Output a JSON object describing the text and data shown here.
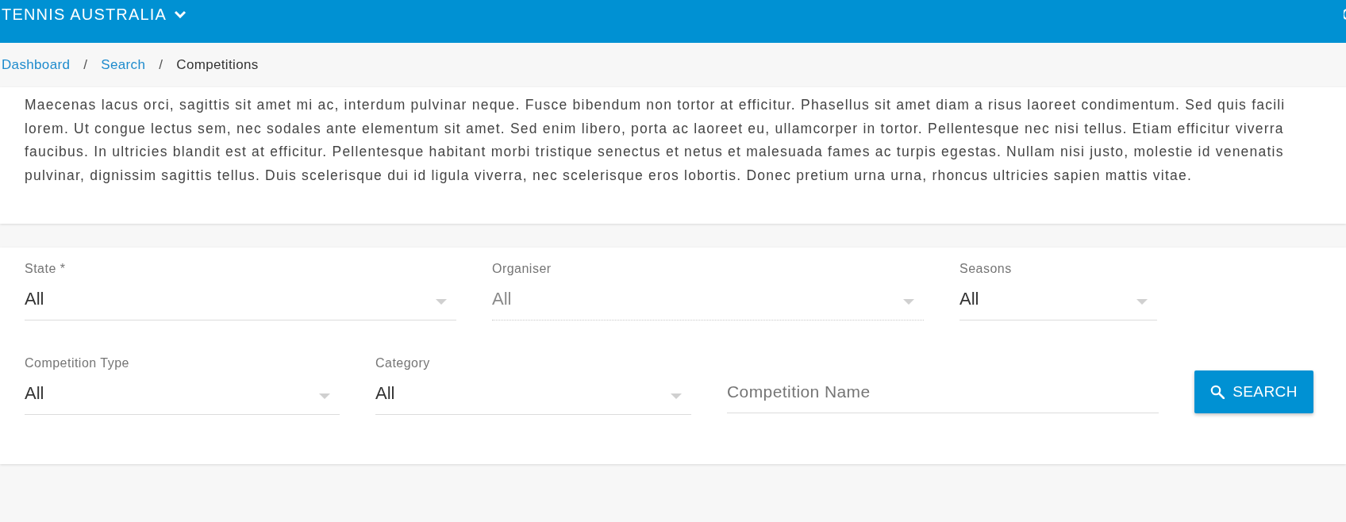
{
  "header": {
    "title": "TENNIS AUSTRALIA"
  },
  "breadcrumbs": [
    {
      "kind": "link",
      "label": "Dashboard"
    },
    {
      "kind": "separator",
      "label": "/"
    },
    {
      "kind": "link",
      "label": "Search"
    },
    {
      "kind": "separator",
      "label": "/"
    },
    {
      "kind": "current",
      "label": "Competitions"
    }
  ],
  "description": {
    "lines": [
      "Maecenas lacus orci, sagittis sit amet mi ac, interdum pulvinar neque. Fusce bibendum non tortor at efficitur. Phasellus sit amet diam a risus laoreet condimentum. Sed quis facili",
      "lorem. Ut congue lectus sem, nec sodales ante elementum sit amet. Sed enim libero, porta ac laoreet eu, ullamcorper in tortor. Pellentesque nec nisi tellus. Etiam efficitur viverra",
      "faucibus. In ultricies blandit est at efficitur. Pellentesque habitant morbi tristique senectus et netus et malesuada fames ac turpis egestas. Nullam nisi justo, molestie id venenatis",
      "pulvinar, dignissim sagittis tellus. Duis scelerisque dui id ligula viverra, nec scelerisque eros lobortis. Donec pretium urna urna, rhoncus ultricies sapien mattis vitae."
    ]
  },
  "filters": {
    "rows": [
      [
        {
          "kind": "select",
          "label": "State *",
          "value": "All",
          "disabled": false
        },
        {
          "kind": "select",
          "label": "Organiser",
          "value": "All",
          "disabled": true
        },
        {
          "kind": "select",
          "label": "Seasons",
          "value": "All",
          "disabled": false
        }
      ],
      [
        {
          "kind": "select",
          "label": "Competition Type",
          "value": "All",
          "disabled": false
        },
        {
          "kind": "select",
          "label": "Category",
          "value": "All",
          "disabled": false
        },
        {
          "kind": "text",
          "placeholder": "Competition Name"
        },
        {
          "kind": "button",
          "label": "SEARCH"
        }
      ]
    ]
  }
}
